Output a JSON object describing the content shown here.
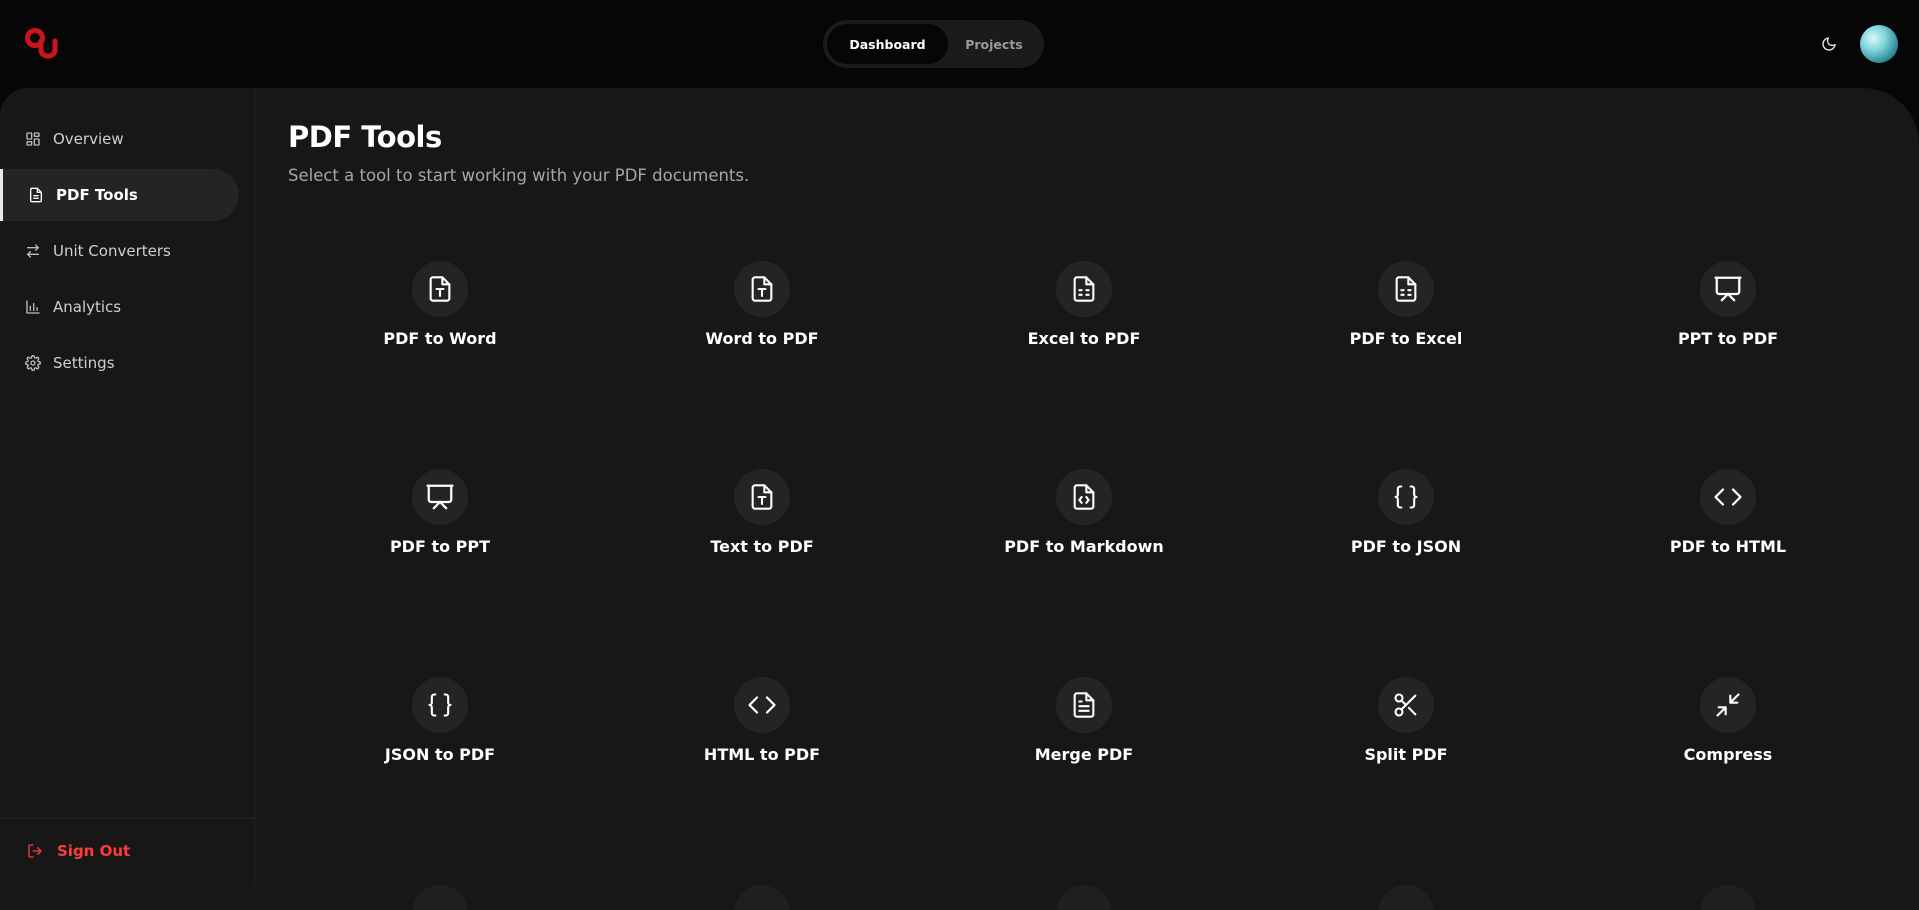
{
  "header": {
    "nav_tabs": [
      {
        "label": "Dashboard",
        "active": true
      },
      {
        "label": "Projects",
        "active": false
      }
    ],
    "theme_icon": "moon-icon",
    "brand_color": "#c9151b"
  },
  "sidebar": {
    "items": [
      {
        "label": "Overview",
        "icon": "grid-icon",
        "active": false
      },
      {
        "label": "PDF Tools",
        "icon": "file-icon",
        "active": true
      },
      {
        "label": "Unit Converters",
        "icon": "arrows-left-right-icon",
        "active": false
      },
      {
        "label": "Analytics",
        "icon": "bar-chart-icon",
        "active": false
      },
      {
        "label": "Settings",
        "icon": "gear-icon",
        "active": false
      }
    ],
    "signout_label": "Sign Out",
    "signout_color": "#ff3b3b"
  },
  "main": {
    "title": "PDF Tools",
    "subtitle": "Select a tool to start working with your PDF documents.",
    "tools": [
      {
        "label": "PDF to Word",
        "icon": "file-text-type-icon"
      },
      {
        "label": "Word to PDF",
        "icon": "file-text-type-icon"
      },
      {
        "label": "Excel to PDF",
        "icon": "file-spreadsheet-icon"
      },
      {
        "label": "PDF to Excel",
        "icon": "file-spreadsheet-icon"
      },
      {
        "label": "PPT to PDF",
        "icon": "presentation-icon"
      },
      {
        "label": "PDF to PPT",
        "icon": "presentation-icon"
      },
      {
        "label": "Text to PDF",
        "icon": "file-text-type-icon"
      },
      {
        "label": "PDF to Markdown",
        "icon": "file-code-icon"
      },
      {
        "label": "PDF to JSON",
        "icon": "braces-icon"
      },
      {
        "label": "PDF to HTML",
        "icon": "code-brackets-icon"
      },
      {
        "label": "JSON to PDF",
        "icon": "braces-icon"
      },
      {
        "label": "HTML to PDF",
        "icon": "code-brackets-icon"
      },
      {
        "label": "Merge PDF",
        "icon": "file-lines-icon"
      },
      {
        "label": "Split PDF",
        "icon": "scissors-icon"
      },
      {
        "label": "Compress",
        "icon": "minimize-icon"
      }
    ]
  }
}
